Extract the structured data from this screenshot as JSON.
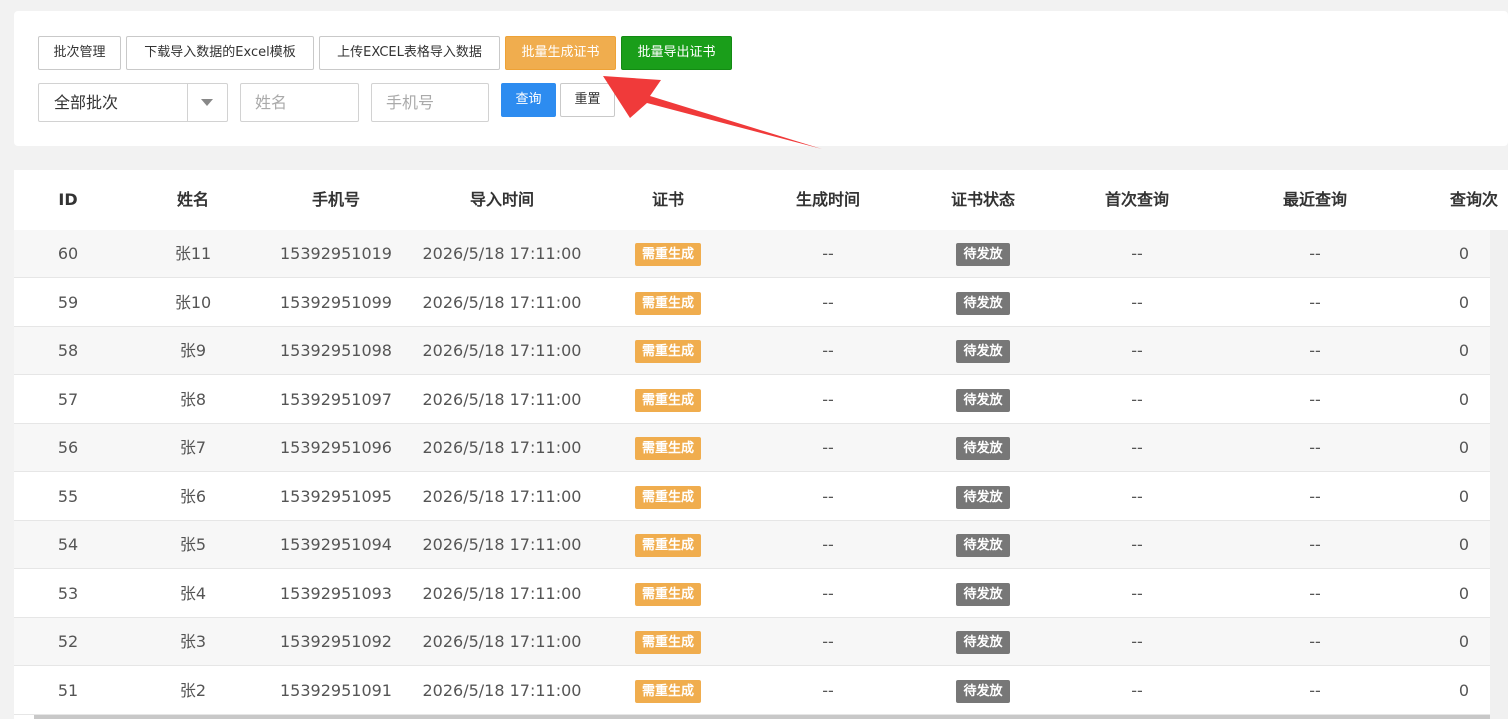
{
  "toolbar": {
    "batch_manage": "批次管理",
    "download_template": "下载导入数据的Excel模板",
    "upload_excel": "上传EXCEL表格导入数据",
    "batch_generate": "批量生成证书",
    "batch_export": "批量导出证书"
  },
  "filters": {
    "batch_select_value": "全部批次",
    "name_placeholder": "姓名",
    "phone_placeholder": "手机号",
    "query_label": "查询",
    "reset_label": "重置"
  },
  "colors": {
    "orange": "#f0ad4e",
    "green": "#1a9e1a",
    "blue": "#2d8cf0",
    "gray_badge": "#777777",
    "arrow": "#f03a3a"
  },
  "table": {
    "headers": {
      "id": "ID",
      "name": "姓名",
      "phone": "手机号",
      "import_time": "导入时间",
      "certificate": "证书",
      "generate_time": "生成时间",
      "cert_status": "证书状态",
      "first_query": "首次查询",
      "last_query": "最近查询",
      "query_count": "查询次"
    },
    "rows": [
      {
        "id": "60",
        "name": "张11",
        "phone": "15392951019",
        "import_time": "2026/5/18 17:11:00",
        "certificate": "需重生成",
        "generate_time": "--",
        "cert_status": "待发放",
        "first_query": "--",
        "last_query": "--",
        "query_count": "0"
      },
      {
        "id": "59",
        "name": "张10",
        "phone": "15392951099",
        "import_time": "2026/5/18 17:11:00",
        "certificate": "需重生成",
        "generate_time": "--",
        "cert_status": "待发放",
        "first_query": "--",
        "last_query": "--",
        "query_count": "0"
      },
      {
        "id": "58",
        "name": "张9",
        "phone": "15392951098",
        "import_time": "2026/5/18 17:11:00",
        "certificate": "需重生成",
        "generate_time": "--",
        "cert_status": "待发放",
        "first_query": "--",
        "last_query": "--",
        "query_count": "0"
      },
      {
        "id": "57",
        "name": "张8",
        "phone": "15392951097",
        "import_time": "2026/5/18 17:11:00",
        "certificate": "需重生成",
        "generate_time": "--",
        "cert_status": "待发放",
        "first_query": "--",
        "last_query": "--",
        "query_count": "0"
      },
      {
        "id": "56",
        "name": "张7",
        "phone": "15392951096",
        "import_time": "2026/5/18 17:11:00",
        "certificate": "需重生成",
        "generate_time": "--",
        "cert_status": "待发放",
        "first_query": "--",
        "last_query": "--",
        "query_count": "0"
      },
      {
        "id": "55",
        "name": "张6",
        "phone": "15392951095",
        "import_time": "2026/5/18 17:11:00",
        "certificate": "需重生成",
        "generate_time": "--",
        "cert_status": "待发放",
        "first_query": "--",
        "last_query": "--",
        "query_count": "0"
      },
      {
        "id": "54",
        "name": "张5",
        "phone": "15392951094",
        "import_time": "2026/5/18 17:11:00",
        "certificate": "需重生成",
        "generate_time": "--",
        "cert_status": "待发放",
        "first_query": "--",
        "last_query": "--",
        "query_count": "0"
      },
      {
        "id": "53",
        "name": "张4",
        "phone": "15392951093",
        "import_time": "2026/5/18 17:11:00",
        "certificate": "需重生成",
        "generate_time": "--",
        "cert_status": "待发放",
        "first_query": "--",
        "last_query": "--",
        "query_count": "0"
      },
      {
        "id": "52",
        "name": "张3",
        "phone": "15392951092",
        "import_time": "2026/5/18 17:11:00",
        "certificate": "需重生成",
        "generate_time": "--",
        "cert_status": "待发放",
        "first_query": "--",
        "last_query": "--",
        "query_count": "0"
      },
      {
        "id": "51",
        "name": "张2",
        "phone": "15392951091",
        "import_time": "2026/5/18 17:11:00",
        "certificate": "需重生成",
        "generate_time": "--",
        "cert_status": "待发放",
        "first_query": "--",
        "last_query": "--",
        "query_count": "0"
      }
    ]
  }
}
